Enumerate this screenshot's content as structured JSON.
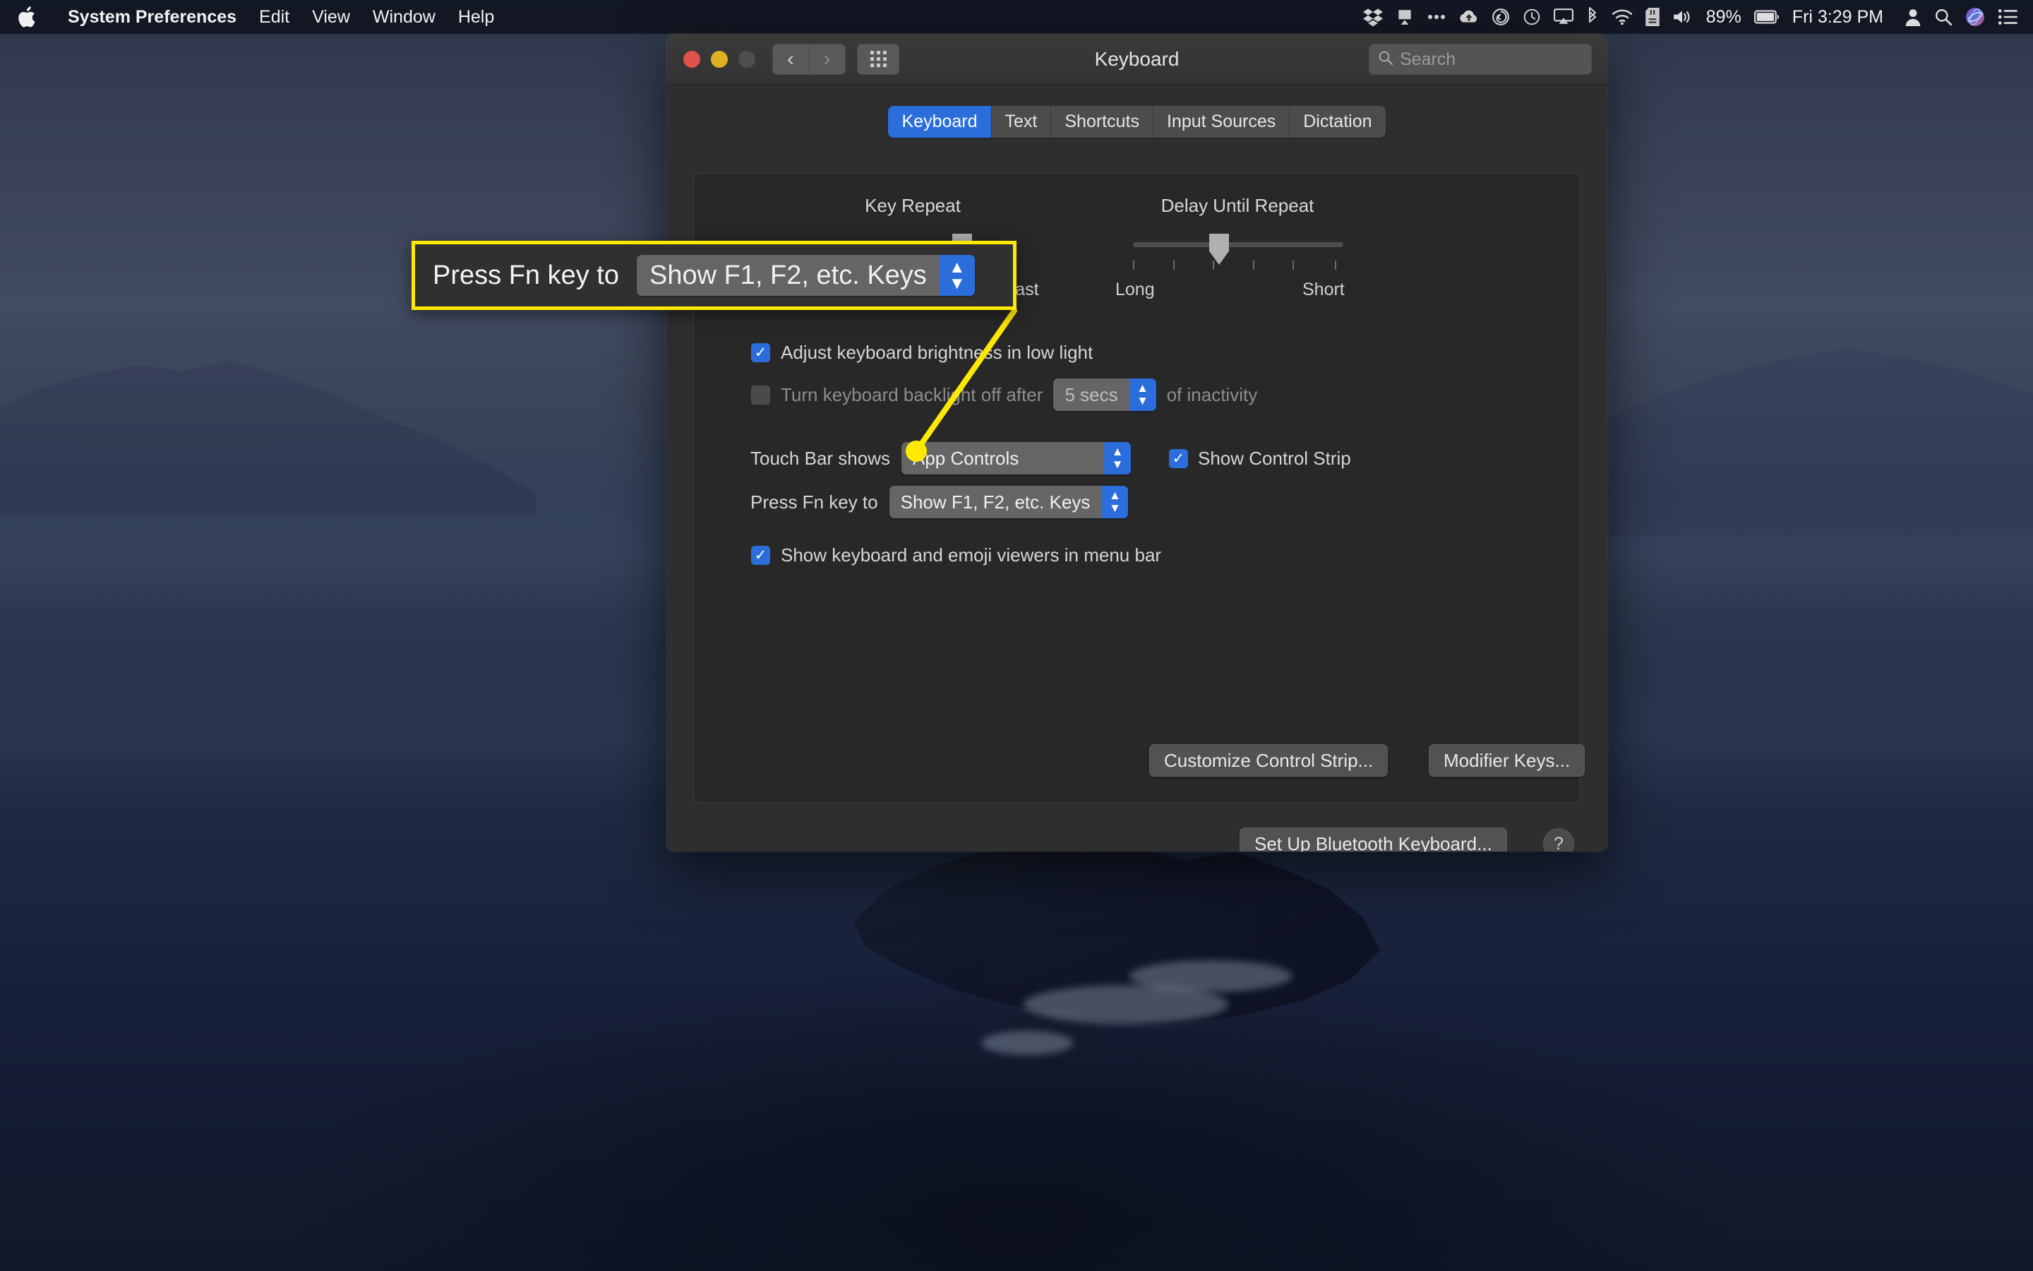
{
  "menubar": {
    "apple_icon": "apple-logo",
    "items": [
      {
        "label": "System Preferences",
        "bold": true
      },
      {
        "label": "Edit",
        "bold": false
      },
      {
        "label": "View",
        "bold": false
      },
      {
        "label": "Window",
        "bold": false
      },
      {
        "label": "Help",
        "bold": false
      }
    ],
    "tray": {
      "icons": [
        "dropbox-icon",
        "airplay-audio-icon",
        "ellipsis-icon",
        "cloud-upload-icon",
        "creative-cloud-icon",
        "time-machine-icon",
        "airplay-display-icon",
        "bluetooth-icon",
        "wifi-icon",
        "sd-card-icon",
        "volume-icon"
      ],
      "battery_percent": "89%",
      "battery_icon": "battery-icon",
      "datetime": "Fri 3:29 PM",
      "right_icons": [
        "user-icon",
        "search-icon",
        "siri-icon",
        "control-center-icon"
      ]
    }
  },
  "window": {
    "title": "Keyboard",
    "traffic_lights": [
      "close-button",
      "minimize-button",
      "zoom-button-disabled"
    ],
    "nav": {
      "back_icon": "chevron-left-icon",
      "forward_icon": "chevron-right-icon",
      "grid_icon": "grid-view-icon"
    },
    "search": {
      "placeholder": "Search",
      "icon": "search-icon",
      "value": ""
    }
  },
  "tabs": [
    {
      "label": "Keyboard",
      "active": true
    },
    {
      "label": "Text",
      "active": false
    },
    {
      "label": "Shortcuts",
      "active": false
    },
    {
      "label": "Input Sources",
      "active": false
    },
    {
      "label": "Dictation",
      "active": false
    }
  ],
  "sliders": {
    "key_repeat": {
      "title": "Key Repeat",
      "end_label_right": "Fast",
      "ticks": 8,
      "value_pct": 72
    },
    "delay_until_repeat": {
      "title": "Delay Until Repeat",
      "end_label_left": "Long",
      "end_label_right": "Short",
      "ticks": 6,
      "value_pct": 41
    }
  },
  "options": {
    "adjust_brightness": {
      "label": "Adjust keyboard brightness in low light",
      "checked": true,
      "check_glyph": "✓"
    },
    "backlight_off": {
      "label_before": "Turn keyboard backlight off after",
      "label_after": "of inactivity",
      "checked": false,
      "popup_value": "5 secs"
    },
    "touch_bar": {
      "label": "Touch Bar shows",
      "popup_value": "App Controls"
    },
    "show_control_strip": {
      "label": "Show Control Strip",
      "checked": true,
      "check_glyph": "✓"
    },
    "press_fn": {
      "label": "Press Fn key to",
      "popup_value": "Show F1, F2, etc. Keys"
    },
    "show_viewers": {
      "label": "Show keyboard and emoji viewers in menu bar",
      "checked": true,
      "check_glyph": "✓"
    }
  },
  "buttons": {
    "customize_control_strip": "Customize Control Strip...",
    "modifier_keys": "Modifier Keys...",
    "set_up_bluetooth_keyboard": "Set Up Bluetooth Keyboard...",
    "help": "?"
  },
  "callout": {
    "label": "Press Fn key to",
    "popup_value": "Show F1, F2, etc. Keys",
    "border_color": "#ffe900",
    "leader_color": "#ffe900"
  },
  "colors": {
    "accent_blue": "#2a6ddb",
    "highlight_yellow": "#ffe900",
    "window_bg": "#2e2e2e",
    "panel_bg": "#282828"
  }
}
